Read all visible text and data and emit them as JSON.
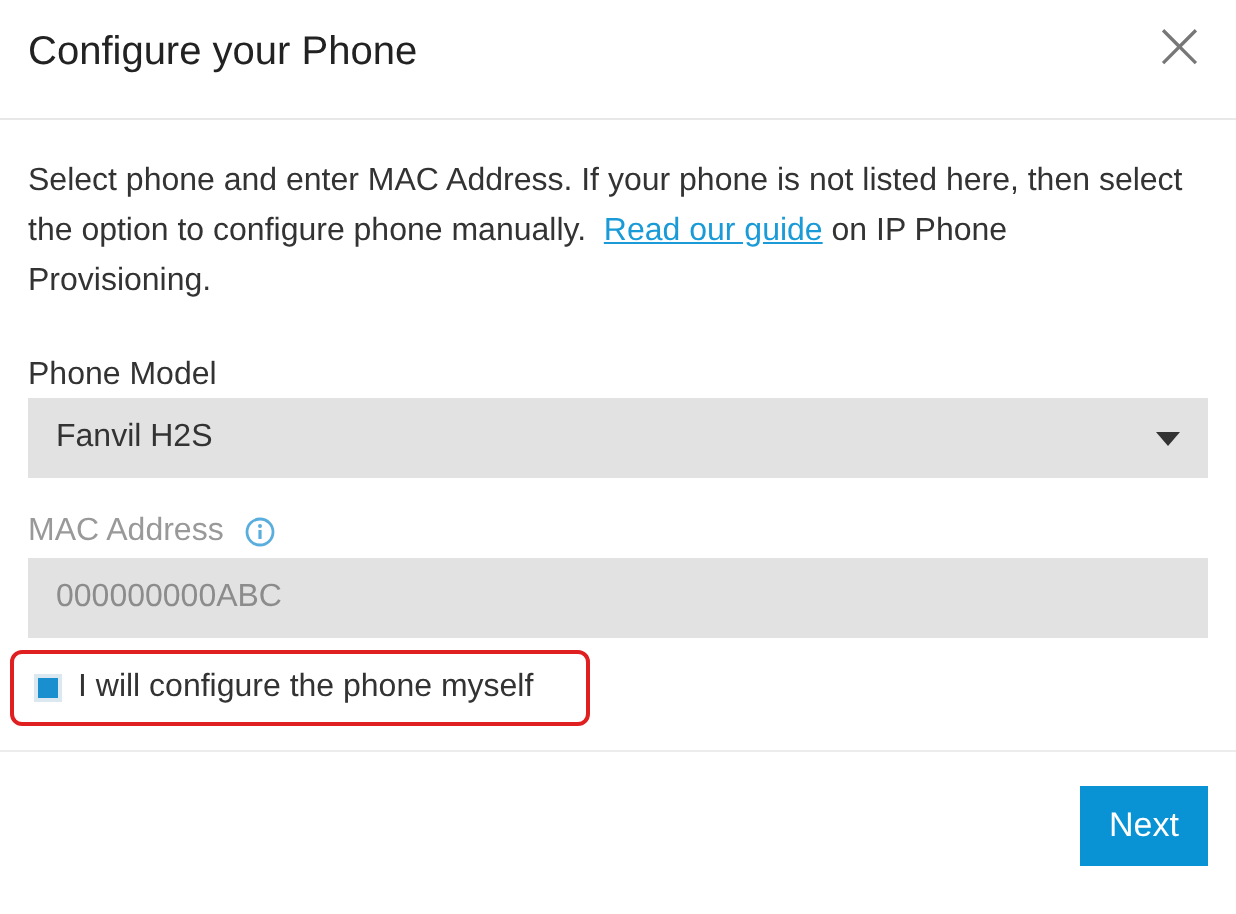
{
  "dialog": {
    "title": "Configure your Phone",
    "close": "×"
  },
  "intro": {
    "before": "Select phone and enter MAC Address. If your phone is not listed here, then select the option to configure phone manually.",
    "link": "Read our guide",
    "after": "on IP Phone Provisioning."
  },
  "phone_model": {
    "label": "Phone Model",
    "value": "Fanvil H2S"
  },
  "mac_address": {
    "label": "MAC Address",
    "placeholder": "000000000ABC",
    "disabled": true
  },
  "checkbox": {
    "label": "I will configure the phone myself",
    "checked": true,
    "highlighted": true
  },
  "buttons": [
    {
      "label": "Next"
    }
  ]
}
